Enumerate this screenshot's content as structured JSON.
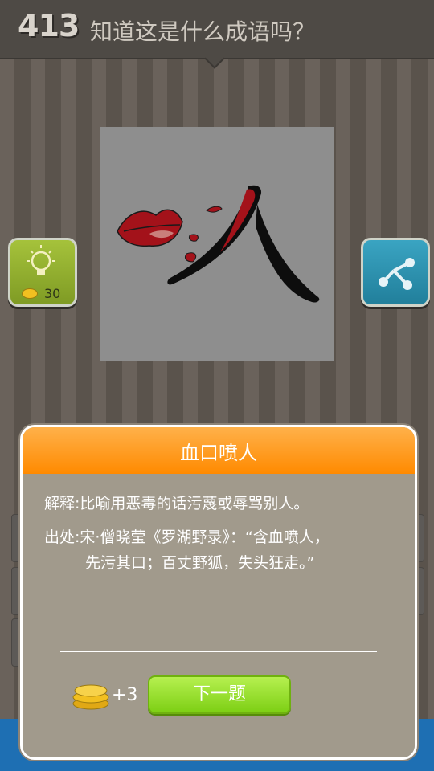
{
  "header": {
    "level": "413",
    "question": "知道这是什么成语吗？"
  },
  "hint": {
    "cost": "30",
    "icon": "lightbulb-icon"
  },
  "share": {
    "icon": "share-icon"
  },
  "puzzle": {
    "description_icon": "lips-with-blood-and-person-character"
  },
  "colors": {
    "header_bg": "#4e4a45",
    "modal_head": "#ff9a1a",
    "next_button": "#8ed82a",
    "hint_button": "#98b532",
    "share_button": "#2f93b1",
    "bottom_strip": "#1e6fb3"
  },
  "modal": {
    "title": "血口喷人",
    "definition": "解释:比喻用恶毒的话污蔑或辱骂别人。",
    "source_line1": "出处:宋·僧晓莹《罗湖野录》：“含血喷人，",
    "source_line2": "先污其口；百丈野狐，失头狂走。”",
    "reward": "+3",
    "next_label": "下一题"
  }
}
